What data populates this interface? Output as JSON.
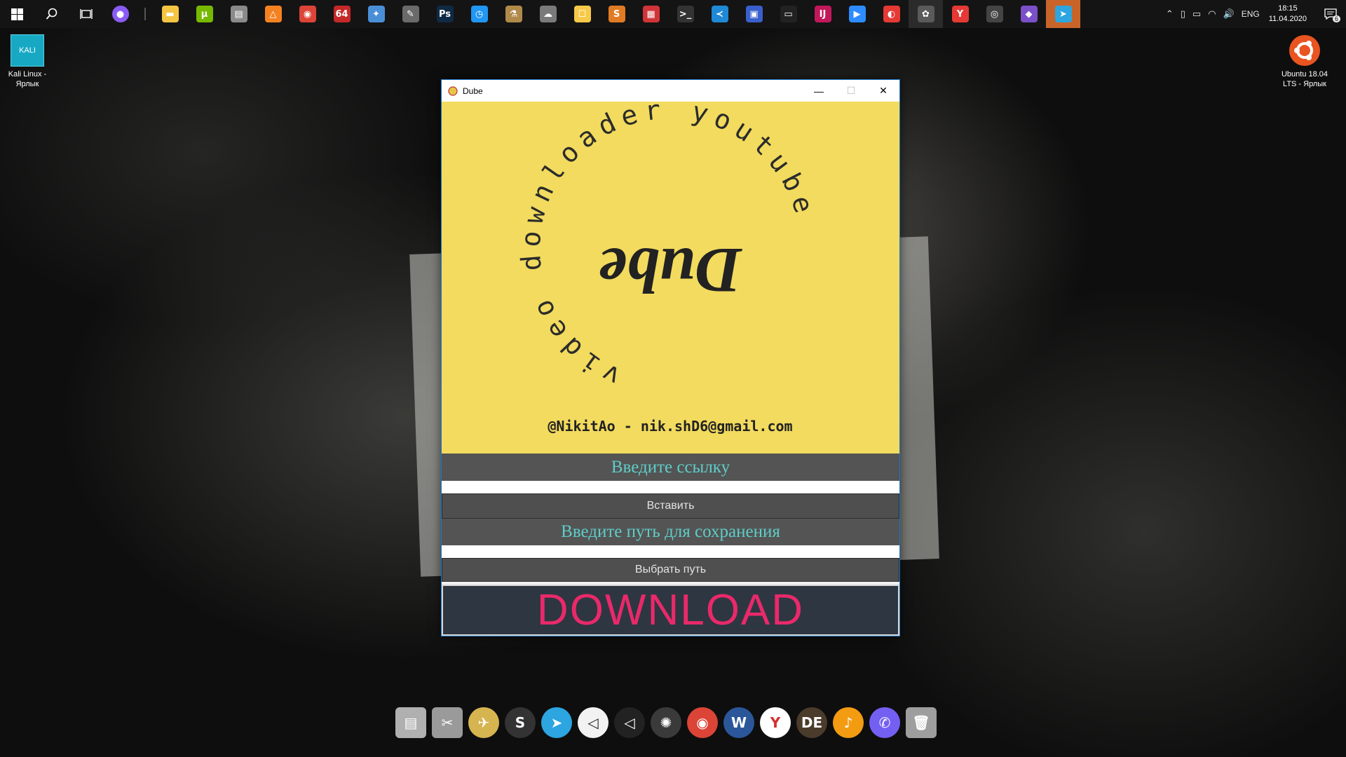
{
  "window": {
    "title": "Dube",
    "minimize_glyph": "—",
    "maximize_glyph": "☐",
    "close_glyph": "✕"
  },
  "banner": {
    "ring_text": "video downloader youtube",
    "logo_text": "Dube",
    "credit": "@NikitAo - nik.shD6@gmail.com",
    "background": "#f2db5e"
  },
  "form": {
    "link_label": "Введите ссылку",
    "link_value": "",
    "paste_button": "Вставить",
    "path_label": "Введите путь для сохранения",
    "path_value": "",
    "choose_path_button": "Выбрать путь",
    "download_button": "DOWNLOAD",
    "accent_label_color": "#5ecdc8",
    "download_text_color": "#e9296a"
  },
  "desktop": {
    "icons": [
      {
        "label": "Kali Linux - Ярлык",
        "icon": "kali-icon",
        "glyph": "KALI"
      },
      {
        "label": "Ubuntu 18.04 LTS - Ярлык",
        "icon": "ubuntu-icon"
      }
    ]
  },
  "taskbar": {
    "apps": [
      {
        "name": "alice",
        "glyph": "●",
        "color": "#8a5cf5"
      },
      {
        "name": "file-explorer",
        "glyph": "▬",
        "color": "#f4c542"
      },
      {
        "name": "utorrent",
        "glyph": "μ",
        "color": "#77b900"
      },
      {
        "name": "disk-tool",
        "glyph": "▤",
        "color": "#8a8a8a"
      },
      {
        "name": "avast",
        "glyph": "△",
        "color": "#f58220"
      },
      {
        "name": "chrome",
        "glyph": "◉",
        "color": "#db4437"
      },
      {
        "name": "aida64",
        "glyph": "64",
        "color": "#c62828"
      },
      {
        "name": "satellite-app",
        "glyph": "✦",
        "color": "#4a8fd6"
      },
      {
        "name": "pen-tool",
        "glyph": "✎",
        "color": "#6a6a6a"
      },
      {
        "name": "photoshop",
        "glyph": "Ps",
        "color": "#0f2a44"
      },
      {
        "name": "timer-app",
        "glyph": "◷",
        "color": "#2196f3"
      },
      {
        "name": "picker-app",
        "glyph": "⚗",
        "color": "#b08a4a"
      },
      {
        "name": "cloud-app",
        "glyph": "☁",
        "color": "#7a7a7a"
      },
      {
        "name": "yandex-disk",
        "glyph": "☐",
        "color": "#f7c948"
      },
      {
        "name": "sublime-text",
        "glyph": "S",
        "color": "#e07b24"
      },
      {
        "name": "ms-office",
        "glyph": "▦",
        "color": "#d13438"
      },
      {
        "name": "terminal",
        "glyph": ">_",
        "color": "#333333"
      },
      {
        "name": "vscode",
        "glyph": "≺",
        "color": "#1f89d6"
      },
      {
        "name": "save-app",
        "glyph": "▣",
        "color": "#3a5fcd"
      },
      {
        "name": "cmd",
        "glyph": "▭",
        "color": "#222222"
      },
      {
        "name": "intellij",
        "glyph": "IJ",
        "color": "#c2185b"
      },
      {
        "name": "zoom",
        "glyph": "▶",
        "color": "#2d8cff"
      },
      {
        "name": "color-app",
        "glyph": "◐",
        "color": "#e53935"
      },
      {
        "name": "python-app",
        "glyph": "✿",
        "color": "#5a5a5a"
      },
      {
        "name": "yandex-browser",
        "glyph": "Y",
        "color": "#e53935"
      },
      {
        "name": "unity",
        "glyph": "◎",
        "color": "#444444"
      },
      {
        "name": "visual-studio",
        "glyph": "◆",
        "color": "#7b4fc7"
      },
      {
        "name": "telegram",
        "glyph": "➤",
        "color": "#2ca5e0"
      }
    ],
    "language": "ENG",
    "time": "18:15",
    "date": "11.04.2020",
    "notifications": "6"
  },
  "dock": {
    "apps": [
      {
        "name": "preview",
        "glyph": "▤",
        "color": "#b0b0b0"
      },
      {
        "name": "scissors-tool",
        "glyph": "✂",
        "color": "#9a9a9a"
      },
      {
        "name": "plane-app",
        "glyph": "✈",
        "color": "#d6b450"
      },
      {
        "name": "sublime-text",
        "glyph": "S",
        "color": "#333333"
      },
      {
        "name": "telegram",
        "glyph": "➤",
        "color": "#2ca5e0"
      },
      {
        "name": "unity",
        "glyph": "◁",
        "color": "#f2f2f2"
      },
      {
        "name": "unity-hub",
        "glyph": "◁",
        "color": "#222222"
      },
      {
        "name": "blender-app",
        "glyph": "✺",
        "color": "#3a3a3a"
      },
      {
        "name": "chrome",
        "glyph": "◉",
        "color": "#db4437"
      },
      {
        "name": "word",
        "glyph": "W",
        "color": "#2b579a"
      },
      {
        "name": "yandex-browser",
        "glyph": "Y",
        "color": "#ffffff"
      },
      {
        "name": "dbeaver",
        "glyph": "DE",
        "color": "#4a3b2a"
      },
      {
        "name": "fl-studio",
        "glyph": "♪",
        "color": "#f39c12"
      },
      {
        "name": "viber",
        "glyph": "✆",
        "color": "#7360f2"
      },
      {
        "name": "trash",
        "glyph": "🗑",
        "color": "#9e9e9e"
      }
    ]
  }
}
